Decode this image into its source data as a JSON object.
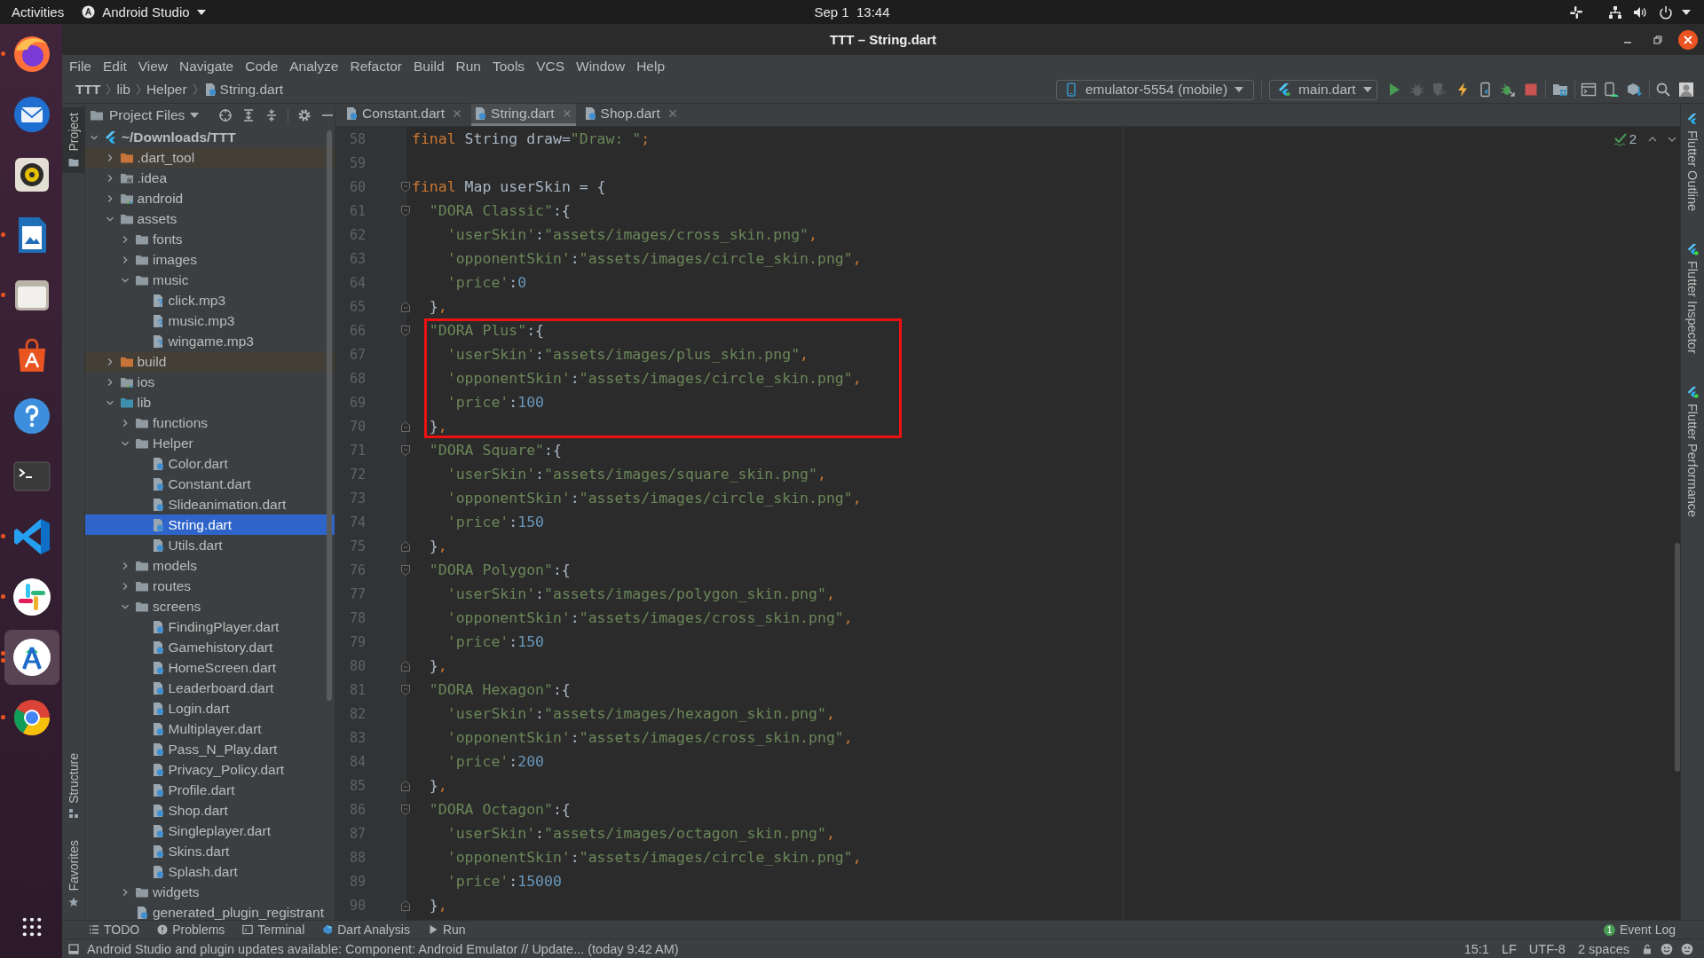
{
  "top_bar": {
    "activities": "Activities",
    "app_menu": "Android Studio",
    "clock": "Sep 1  13:44"
  },
  "dock": {
    "apps": [
      {
        "kind": "fox",
        "selected": false,
        "running": true,
        "multiple": false
      },
      {
        "kind": "mail",
        "selected": false,
        "running": false,
        "multiple": false
      },
      {
        "kind": "speaker",
        "selected": false,
        "running": false,
        "multiple": false
      },
      {
        "kind": "writer",
        "selected": false,
        "running": true,
        "multiple": false
      },
      {
        "kind": "files",
        "selected": false,
        "running": true,
        "multiple": false
      },
      {
        "kind": "store",
        "selected": false,
        "running": false,
        "multiple": false
      },
      {
        "kind": "help",
        "selected": false,
        "running": false,
        "multiple": false
      },
      {
        "kind": "terminal",
        "selected": false,
        "running": false,
        "multiple": false
      },
      {
        "kind": "code",
        "selected": false,
        "running": true,
        "multiple": false
      },
      {
        "kind": "chat",
        "selected": false,
        "running": true,
        "multiple": false
      },
      {
        "kind": "studio",
        "selected": true,
        "running": true,
        "multiple": true
      },
      {
        "kind": "wheel",
        "selected": false,
        "running": true,
        "multiple": false
      }
    ]
  },
  "window": {
    "title": "TTT – String.dart"
  },
  "menu": [
    "File",
    "Edit",
    "View",
    "Navigate",
    "Code",
    "Analyze",
    "Refactor",
    "Build",
    "Run",
    "Tools",
    "VCS",
    "Window",
    "Help"
  ],
  "breadcrumb": [
    {
      "kind": "project",
      "label": "TTT"
    },
    {
      "kind": "folder",
      "label": "lib"
    },
    {
      "kind": "folder",
      "label": "Helper"
    },
    {
      "kind": "file",
      "label": "String.dart"
    }
  ],
  "toolbar": {
    "device": "emulator-5554 (mobile)",
    "config": "main.dart",
    "buttons": [
      {
        "kind": "run",
        "disabled": false
      },
      {
        "kind": "debug",
        "disabled": true
      },
      {
        "kind": "coverage",
        "disabled": true
      },
      {
        "kind": "reload",
        "disabled": false
      },
      {
        "kind": "devtools",
        "disabled": false
      },
      {
        "kind": "attach",
        "disabled": false
      },
      {
        "kind": "stop",
        "disabled": false
      },
      {
        "kind": "structure",
        "disabled": false
      },
      {
        "kind": "console",
        "disabled": false
      },
      {
        "kind": "avd",
        "disabled": false
      },
      {
        "kind": "sdk",
        "disabled": false
      },
      {
        "kind": "search",
        "disabled": false
      },
      {
        "kind": "account",
        "disabled": false
      }
    ]
  },
  "left_strip": {
    "top": [
      {
        "kind": "folder",
        "label": "Project",
        "selected": true
      }
    ],
    "bottom": [
      {
        "kind": "structure",
        "label": "Structure",
        "selected": false
      },
      {
        "kind": "star",
        "label": "Favorites",
        "selected": false
      }
    ]
  },
  "project_panel": {
    "view": "Project Files",
    "tree": [
      {
        "label": "~/Downloads/TTT",
        "kind": "project",
        "expanded": true,
        "selected": false,
        "children": [
          {
            "label": ".dart_tool",
            "kind": "excluded",
            "expanded": false,
            "selected": false
          },
          {
            "label": ".idea",
            "kind": "config",
            "expanded": false,
            "selected": false
          },
          {
            "label": "android",
            "kind": "module",
            "expanded": false,
            "selected": false
          },
          {
            "label": "assets",
            "kind": "folder",
            "expanded": true,
            "selected": false,
            "children": [
              {
                "label": "fonts",
                "kind": "folder",
                "expanded": false,
                "selected": false
              },
              {
                "label": "images",
                "kind": "folder",
                "expanded": false,
                "selected": false
              },
              {
                "label": "music",
                "kind": "folder",
                "expanded": true,
                "selected": false,
                "children": [
                  {
                    "label": "click.mp3",
                    "kind": "unknown",
                    "selected": false
                  },
                  {
                    "label": "music.mp3",
                    "kind": "unknown",
                    "selected": false
                  },
                  {
                    "label": "wingame.mp3",
                    "kind": "unknown",
                    "selected": false
                  }
                ]
              }
            ]
          },
          {
            "label": "build",
            "kind": "excluded",
            "expanded": false,
            "selected": false
          },
          {
            "label": "ios",
            "kind": "module",
            "expanded": false,
            "selected": false
          },
          {
            "label": "lib",
            "kind": "source",
            "expanded": true,
            "selected": false,
            "children": [
              {
                "label": "functions",
                "kind": "folder",
                "expanded": false,
                "selected": false
              },
              {
                "label": "Helper",
                "kind": "folder",
                "expanded": true,
                "selected": false,
                "children": [
                  {
                    "label": "Color.dart",
                    "kind": "dart",
                    "selected": false
                  },
                  {
                    "label": "Constant.dart",
                    "kind": "dart",
                    "selected": false
                  },
                  {
                    "label": "Slideanimation.dart",
                    "kind": "dart",
                    "selected": false
                  },
                  {
                    "label": "String.dart",
                    "kind": "dart",
                    "selected": true
                  },
                  {
                    "label": "Utils.dart",
                    "kind": "dart",
                    "selected": false
                  }
                ]
              },
              {
                "label": "models",
                "kind": "folder",
                "expanded": false,
                "selected": false
              },
              {
                "label": "routes",
                "kind": "folder",
                "expanded": false,
                "selected": false
              },
              {
                "label": "screens",
                "kind": "folder",
                "expanded": true,
                "selected": false,
                "children": [
                  {
                    "label": "FindingPlayer.dart",
                    "kind": "dart",
                    "selected": false
                  },
                  {
                    "label": "Gamehistory.dart",
                    "kind": "dart",
                    "selected": false
                  },
                  {
                    "label": "HomeScreen.dart",
                    "kind": "dart",
                    "selected": false
                  },
                  {
                    "label": "Leaderboard.dart",
                    "kind": "dart",
                    "selected": false
                  },
                  {
                    "label": "Login.dart",
                    "kind": "dart",
                    "selected": false
                  },
                  {
                    "label": "Multiplayer.dart",
                    "kind": "dart",
                    "selected": false
                  },
                  {
                    "label": "Pass_N_Play.dart",
                    "kind": "dart",
                    "selected": false
                  },
                  {
                    "label": "Privacy_Policy.dart",
                    "kind": "dart",
                    "selected": false
                  },
                  {
                    "label": "Profile.dart",
                    "kind": "dart",
                    "selected": false
                  },
                  {
                    "label": "Shop.dart",
                    "kind": "dart",
                    "selected": false
                  },
                  {
                    "label": "Singleplayer.dart",
                    "kind": "dart",
                    "selected": false
                  },
                  {
                    "label": "Skins.dart",
                    "kind": "dart",
                    "selected": false
                  },
                  {
                    "label": "Splash.dart",
                    "kind": "dart",
                    "selected": false
                  }
                ]
              },
              {
                "label": "widgets",
                "kind": "folder",
                "expanded": false,
                "selected": false
              },
              {
                "label": "generated_plugin_registrant",
                "kind": "dart",
                "selected": false
              }
            ]
          }
        ]
      }
    ]
  },
  "editor": {
    "tabs": [
      {
        "label": "Constant.dart",
        "selected": false
      },
      {
        "label": "String.dart",
        "selected": true
      },
      {
        "label": "Shop.dart",
        "selected": false
      }
    ],
    "inspections": "2",
    "lines": [
      {
        "number": "58",
        "kind": "plain",
        "boxed": false,
        "tokens": [
          {
            "kind": "keyword",
            "text": "final"
          },
          {
            "kind": "plain",
            "text": " String draw="
          },
          {
            "kind": "string",
            "text": "\"Draw: \""
          },
          {
            "kind": "punct",
            "text": ";"
          }
        ]
      },
      {
        "number": "59",
        "kind": "plain",
        "boxed": false
      },
      {
        "number": "60",
        "kind": "opener",
        "boxed": false,
        "tokens": [
          {
            "kind": "keyword",
            "text": "final"
          },
          {
            "kind": "plain",
            "text": " Map userSkin = {"
          }
        ]
      },
      {
        "number": "61",
        "kind": "opener",
        "boxed": false,
        "tokens": [
          {
            "kind": "string",
            "text": "  \"DORA Classic\""
          },
          {
            "kind": "plain",
            "text": ":{"
          }
        ]
      },
      {
        "number": "62",
        "kind": "plain",
        "boxed": false,
        "tokens": [
          {
            "kind": "string",
            "text": "    'userSkin'"
          },
          {
            "kind": "plain",
            "text": ":"
          },
          {
            "kind": "string",
            "text": "\"assets/images/cross_skin.png\""
          },
          {
            "kind": "punct",
            "text": ","
          }
        ]
      },
      {
        "number": "63",
        "kind": "plain",
        "boxed": false,
        "tokens": [
          {
            "kind": "string",
            "text": "    'opponentSkin'"
          },
          {
            "kind": "plain",
            "text": ":"
          },
          {
            "kind": "string",
            "text": "\"assets/images/circle_skin.png\""
          },
          {
            "kind": "punct",
            "text": ","
          }
        ]
      },
      {
        "number": "64",
        "kind": "plain",
        "boxed": false,
        "tokens": [
          {
            "kind": "string",
            "text": "    'price'"
          },
          {
            "kind": "plain",
            "text": ":"
          },
          {
            "kind": "number",
            "text": "0"
          }
        ]
      },
      {
        "number": "65",
        "kind": "closer",
        "boxed": false,
        "tokens": [
          {
            "kind": "plain",
            "text": "  }"
          },
          {
            "kind": "punct",
            "text": ","
          }
        ]
      },
      {
        "number": "66",
        "kind": "opener",
        "boxed": true,
        "tokens": [
          {
            "kind": "string",
            "text": "  \"DORA Plus\""
          },
          {
            "kind": "plain",
            "text": ":{"
          }
        ]
      },
      {
        "number": "67",
        "kind": "plain",
        "boxed": true,
        "tokens": [
          {
            "kind": "string",
            "text": "    'userSkin'"
          },
          {
            "kind": "plain",
            "text": ":"
          },
          {
            "kind": "string",
            "text": "\"assets/images/plus_skin.png\""
          },
          {
            "kind": "punct",
            "text": ","
          }
        ]
      },
      {
        "number": "68",
        "kind": "plain",
        "boxed": true,
        "tokens": [
          {
            "kind": "string",
            "text": "    'opponentSkin'"
          },
          {
            "kind": "plain",
            "text": ":"
          },
          {
            "kind": "string",
            "text": "\"assets/images/circle_skin.png\""
          },
          {
            "kind": "punct",
            "text": ","
          }
        ]
      },
      {
        "number": "69",
        "kind": "plain",
        "boxed": true,
        "tokens": [
          {
            "kind": "string",
            "text": "    'price'"
          },
          {
            "kind": "plain",
            "text": ":"
          },
          {
            "kind": "number",
            "text": "100"
          }
        ]
      },
      {
        "number": "70",
        "kind": "closer",
        "boxed": true,
        "tokens": [
          {
            "kind": "plain",
            "text": "  }"
          },
          {
            "kind": "punct",
            "text": ","
          }
        ]
      },
      {
        "number": "71",
        "kind": "opener",
        "boxed": false,
        "tokens": [
          {
            "kind": "string",
            "text": "  \"DORA Square\""
          },
          {
            "kind": "plain",
            "text": ":{"
          }
        ]
      },
      {
        "number": "72",
        "kind": "plain",
        "boxed": false,
        "tokens": [
          {
            "kind": "string",
            "text": "    'userSkin'"
          },
          {
            "kind": "plain",
            "text": ":"
          },
          {
            "kind": "string",
            "text": "\"assets/images/square_skin.png\""
          },
          {
            "kind": "punct",
            "text": ","
          }
        ]
      },
      {
        "number": "73",
        "kind": "plain",
        "boxed": false,
        "tokens": [
          {
            "kind": "string",
            "text": "    'opponentSkin'"
          },
          {
            "kind": "plain",
            "text": ":"
          },
          {
            "kind": "string",
            "text": "\"assets/images/circle_skin.png\""
          },
          {
            "kind": "punct",
            "text": ","
          }
        ]
      },
      {
        "number": "74",
        "kind": "plain",
        "boxed": false,
        "tokens": [
          {
            "kind": "string",
            "text": "    'price'"
          },
          {
            "kind": "plain",
            "text": ":"
          },
          {
            "kind": "number",
            "text": "150"
          }
        ]
      },
      {
        "number": "75",
        "kind": "closer",
        "boxed": false,
        "tokens": [
          {
            "kind": "plain",
            "text": "  }"
          },
          {
            "kind": "punct",
            "text": ","
          }
        ]
      },
      {
        "number": "76",
        "kind": "opener",
        "boxed": false,
        "tokens": [
          {
            "kind": "string",
            "text": "  \"DORA Polygon\""
          },
          {
            "kind": "plain",
            "text": ":{"
          }
        ]
      },
      {
        "number": "77",
        "kind": "plain",
        "boxed": false,
        "tokens": [
          {
            "kind": "string",
            "text": "    'userSkin'"
          },
          {
            "kind": "plain",
            "text": ":"
          },
          {
            "kind": "string",
            "text": "\"assets/images/polygon_skin.png\""
          },
          {
            "kind": "punct",
            "text": ","
          }
        ]
      },
      {
        "number": "78",
        "kind": "plain",
        "boxed": false,
        "tokens": [
          {
            "kind": "string",
            "text": "    'opponentSkin'"
          },
          {
            "kind": "plain",
            "text": ":"
          },
          {
            "kind": "string",
            "text": "\"assets/images/cross_skin.png\""
          },
          {
            "kind": "punct",
            "text": ","
          }
        ]
      },
      {
        "number": "79",
        "kind": "plain",
        "boxed": false,
        "tokens": [
          {
            "kind": "string",
            "text": "    'price'"
          },
          {
            "kind": "plain",
            "text": ":"
          },
          {
            "kind": "number",
            "text": "150"
          }
        ]
      },
      {
        "number": "80",
        "kind": "closer",
        "boxed": false,
        "tokens": [
          {
            "kind": "plain",
            "text": "  }"
          },
          {
            "kind": "punct",
            "text": ","
          }
        ]
      },
      {
        "number": "81",
        "kind": "opener",
        "boxed": false,
        "tokens": [
          {
            "kind": "string",
            "text": "  \"DORA Hexagon\""
          },
          {
            "kind": "plain",
            "text": ":{"
          }
        ]
      },
      {
        "number": "82",
        "kind": "plain",
        "boxed": false,
        "tokens": [
          {
            "kind": "string",
            "text": "    'userSkin'"
          },
          {
            "kind": "plain",
            "text": ":"
          },
          {
            "kind": "string",
            "text": "\"assets/images/hexagon_skin.png\""
          },
          {
            "kind": "punct",
            "text": ","
          }
        ]
      },
      {
        "number": "83",
        "kind": "plain",
        "boxed": false,
        "tokens": [
          {
            "kind": "string",
            "text": "    'opponentSkin'"
          },
          {
            "kind": "plain",
            "text": ":"
          },
          {
            "kind": "string",
            "text": "\"assets/images/cross_skin.png\""
          },
          {
            "kind": "punct",
            "text": ","
          }
        ]
      },
      {
        "number": "84",
        "kind": "plain",
        "boxed": false,
        "tokens": [
          {
            "kind": "string",
            "text": "    'price'"
          },
          {
            "kind": "plain",
            "text": ":"
          },
          {
            "kind": "number",
            "text": "200"
          }
        ]
      },
      {
        "number": "85",
        "kind": "closer",
        "boxed": false,
        "tokens": [
          {
            "kind": "plain",
            "text": "  }"
          },
          {
            "kind": "punct",
            "text": ","
          }
        ]
      },
      {
        "number": "86",
        "kind": "opener",
        "boxed": false,
        "tokens": [
          {
            "kind": "string",
            "text": "  \"DORA Octagon\""
          },
          {
            "kind": "plain",
            "text": ":{"
          }
        ]
      },
      {
        "number": "87",
        "kind": "plain",
        "boxed": false,
        "tokens": [
          {
            "kind": "string",
            "text": "    'userSkin'"
          },
          {
            "kind": "plain",
            "text": ":"
          },
          {
            "kind": "string",
            "text": "\"assets/images/octagon_skin.png\""
          },
          {
            "kind": "punct",
            "text": ","
          }
        ]
      },
      {
        "number": "88",
        "kind": "plain",
        "boxed": false,
        "tokens": [
          {
            "kind": "string",
            "text": "    'opponentSkin'"
          },
          {
            "kind": "plain",
            "text": ":"
          },
          {
            "kind": "string",
            "text": "\"assets/images/circle_skin.png\""
          },
          {
            "kind": "punct",
            "text": ","
          }
        ]
      },
      {
        "number": "89",
        "kind": "plain",
        "boxed": false,
        "tokens": [
          {
            "kind": "string",
            "text": "    'price'"
          },
          {
            "kind": "plain",
            "text": ":"
          },
          {
            "kind": "number",
            "text": "15000"
          }
        ]
      },
      {
        "number": "90",
        "kind": "closer",
        "boxed": false,
        "tokens": [
          {
            "kind": "plain",
            "text": "  }"
          },
          {
            "kind": "punct",
            "text": ","
          }
        ]
      }
    ]
  },
  "right_strip": [
    {
      "label": "Flutter Outline",
      "status_dot": false
    },
    {
      "label": "Flutter Inspector",
      "status_dot": true
    },
    {
      "label": "Flutter Performance",
      "status_dot": true
    }
  ],
  "tool_bar": {
    "items": [
      {
        "kind": "list",
        "label": "TODO"
      },
      {
        "kind": "info",
        "label": "Problems"
      },
      {
        "kind": "console",
        "label": "Terminal"
      },
      {
        "kind": "dart",
        "label": "Dart Analysis"
      },
      {
        "kind": "play",
        "label": "Run"
      }
    ],
    "event_log": {
      "label": "Event Log",
      "count": "1"
    }
  },
  "status_bar": {
    "message": "Android Studio and plugin updates available: Component: Android Emulator // Update... (today 9:42 AM)",
    "position": "15:1",
    "line_ending": "LF",
    "encoding": "UTF-8",
    "indent": "2 spaces"
  }
}
